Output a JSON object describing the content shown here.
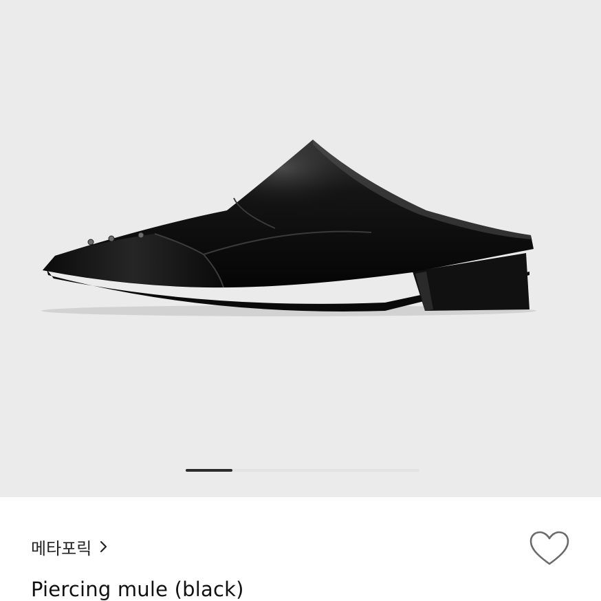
{
  "product": {
    "store_name": "메타포릭",
    "title": "Piercing mule (black)"
  },
  "gallery": {
    "current_index": 1,
    "image_count": 5
  },
  "icons": {
    "store_chevron": "chevron-right-icon",
    "like": "heart-outline-icon"
  },
  "colors": {
    "gallery_bg": "#ebebeb",
    "pager_active": "#2b2b2b",
    "text": "#111111"
  }
}
